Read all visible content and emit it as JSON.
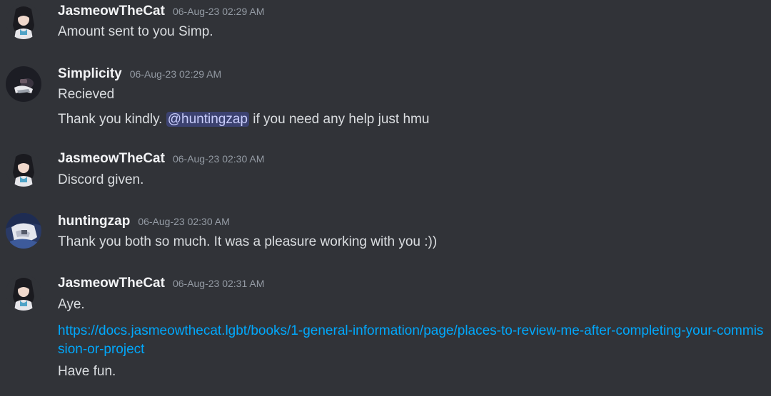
{
  "messages": [
    {
      "author": "JasmeowTheCat",
      "timestamp": "06-Aug-23 02:29 AM",
      "lines": [
        "Amount sent to you Simp."
      ]
    },
    {
      "author": "Simplicity",
      "timestamp": "06-Aug-23 02:29 AM",
      "lines": [
        "Recieved"
      ],
      "line2": {
        "before": "Thank you kindly.",
        "mention": "@huntingzap",
        "after": "if you need any help just hmu"
      }
    },
    {
      "author": "JasmeowTheCat",
      "timestamp": "06-Aug-23 02:30 AM",
      "lines": [
        "Discord given."
      ]
    },
    {
      "author": "huntingzap",
      "timestamp": "06-Aug-23 02:30 AM",
      "lines": [
        "Thank you both so much. It was a pleasure working with you :))"
      ]
    },
    {
      "author": "JasmeowTheCat",
      "timestamp": "06-Aug-23 02:31 AM",
      "lines": [
        "Aye."
      ],
      "link": "https://docs.jasmeowthecat.lgbt/books/1-general-information/page/places-to-review-me-after-completing-your-commission-or-project",
      "after_link": "Have fun."
    }
  ],
  "colors": {
    "background": "#313338",
    "username": "#f2f3f5",
    "timestamp": "#949ba4",
    "text": "#dbdee1",
    "link": "#00a8fc",
    "mention_bg": "#3c4270"
  }
}
